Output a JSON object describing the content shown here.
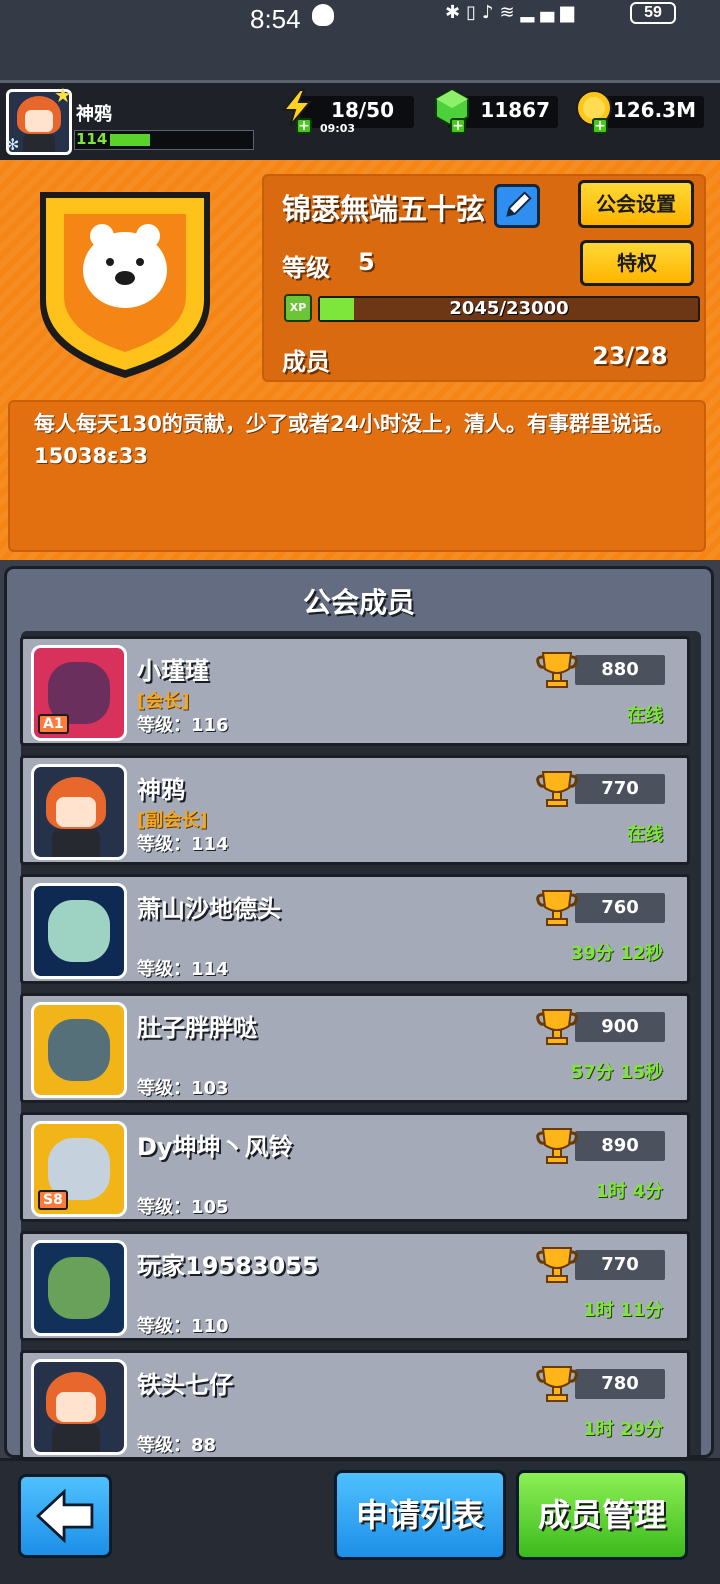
{
  "status_bar": {
    "time": "8:54",
    "battery": "59"
  },
  "player": {
    "name": "神鸦",
    "level": "114"
  },
  "resources": {
    "energy": {
      "value": "18/50",
      "timer": "09:03"
    },
    "gems": {
      "value": "11867"
    },
    "gold": {
      "value": "126.3M"
    }
  },
  "guild": {
    "name": "锦瑟無端五十弦",
    "settings_label": "公会设置",
    "privilege_label": "特权",
    "level_label": "等级",
    "level_value": "5",
    "xp_badge": "XP",
    "xp_text": "2045/23000",
    "xp_fraction": 0.089,
    "members_label": "成员",
    "members_value": "23/28",
    "description": "每人每天130的贡献，少了或者24小时没上，清人。有事群里说话。15038ɛ33"
  },
  "members_title": "公会成员",
  "members": [
    {
      "name": "小瑾瑾",
      "role": "[会长]",
      "level": "等级：116",
      "score": "880",
      "status": "在线",
      "avatar": "dino",
      "tag": "A1"
    },
    {
      "name": "神鸦",
      "role": "[副会长]",
      "level": "等级：114",
      "score": "770",
      "status": "在线",
      "avatar": "redhair",
      "tag": ""
    },
    {
      "name": "萧山沙地德头",
      "role": "",
      "level": "等级：114",
      "score": "760",
      "status": "39分 12秒",
      "avatar": "squid",
      "tag": ""
    },
    {
      "name": "肚子胖胖哒",
      "role": "",
      "level": "等级：103",
      "score": "900",
      "status": "57分 15秒",
      "avatar": "pirate",
      "tag": ""
    },
    {
      "name": "Dy坤坤丶风铃",
      "role": "",
      "level": "等级：105",
      "score": "890",
      "status": "1时 4分",
      "avatar": "rhino",
      "tag": "S8"
    },
    {
      "name": "玩家19583055",
      "role": "",
      "level": "等级：110",
      "score": "770",
      "status": "1时 11分",
      "avatar": "zombie",
      "tag": ""
    },
    {
      "name": "铁头七仔",
      "role": "",
      "level": "等级：88",
      "score": "780",
      "status": "1时 29分",
      "avatar": "redhair",
      "tag": ""
    }
  ],
  "bottom": {
    "apply_list": "申请列表",
    "member_manage": "成员管理"
  },
  "colors": {
    "orange_panel": "#f58615",
    "online_green": "#7ee63b",
    "button_yellow": "#ffc21a",
    "button_blue": "#2f9af0",
    "button_green": "#4ecb2a"
  }
}
